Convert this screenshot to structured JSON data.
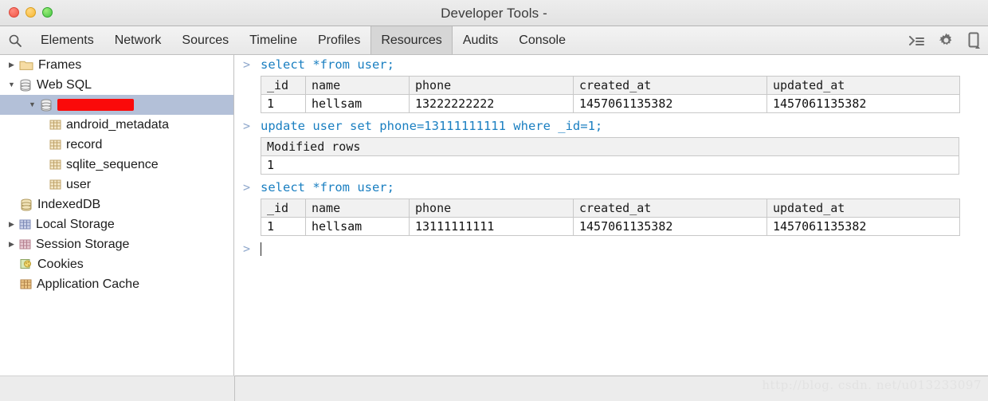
{
  "window": {
    "title": "Developer Tools -",
    "traffic_lights": [
      "close-red",
      "minimize-yellow",
      "zoom-green"
    ]
  },
  "toolbar": {
    "search_icon": "search-icon",
    "tabs": [
      {
        "label": "Elements",
        "active": false
      },
      {
        "label": "Network",
        "active": false
      },
      {
        "label": "Sources",
        "active": false
      },
      {
        "label": "Timeline",
        "active": false
      },
      {
        "label": "Profiles",
        "active": false
      },
      {
        "label": "Resources",
        "active": true
      },
      {
        "label": "Audits",
        "active": false
      },
      {
        "label": "Console",
        "active": false
      }
    ],
    "right_icons": [
      "console-drawer-icon",
      "gear-icon",
      "device-toolbar-icon"
    ]
  },
  "sidebar": {
    "items": [
      {
        "label": "Frames",
        "icon": "folder-icon",
        "twisty": "collapsed",
        "indent": 0,
        "selected": false
      },
      {
        "label": "Web SQL",
        "icon": "database-icon",
        "twisty": "expanded",
        "indent": 0,
        "selected": false
      },
      {
        "label": "",
        "icon": "database-icon",
        "twisty": "expanded",
        "indent": 1,
        "selected": true,
        "redacted": true
      },
      {
        "label": "android_metadata",
        "icon": "table-icon",
        "twisty": "none",
        "indent": 2,
        "selected": false
      },
      {
        "label": "record",
        "icon": "table-icon",
        "twisty": "none",
        "indent": 2,
        "selected": false
      },
      {
        "label": "sqlite_sequence",
        "icon": "table-icon",
        "twisty": "none",
        "indent": 2,
        "selected": false
      },
      {
        "label": "user",
        "icon": "table-icon",
        "twisty": "none",
        "indent": 2,
        "selected": false
      },
      {
        "label": "IndexedDB",
        "icon": "database-icon",
        "twisty": "none",
        "indent": 0,
        "selected": false
      },
      {
        "label": "Local Storage",
        "icon": "grid-blue-icon",
        "twisty": "collapsed",
        "indent": 0,
        "selected": false
      },
      {
        "label": "Session Storage",
        "icon": "grid-pink-icon",
        "twisty": "collapsed",
        "indent": 0,
        "selected": false
      },
      {
        "label": "Cookies",
        "icon": "cookie-icon",
        "twisty": "none",
        "indent": 0,
        "selected": false
      },
      {
        "label": "Application Cache",
        "icon": "grid-orange-icon",
        "twisty": "none",
        "indent": 0,
        "selected": false
      }
    ]
  },
  "console": {
    "prompt_symbol": ">",
    "entries": [
      {
        "type": "query",
        "command": "select *from user;",
        "columns": [
          "_id",
          "name",
          "phone",
          "created_at",
          "updated_at"
        ],
        "rows": [
          [
            "1",
            "hellsam",
            "13222222222",
            "1457061135382",
            "1457061135382"
          ]
        ]
      },
      {
        "type": "update",
        "command": "update user set phone=13111111111 where _id=1;",
        "columns": [
          "Modified rows"
        ],
        "rows": [
          [
            "1"
          ]
        ]
      },
      {
        "type": "query",
        "command": "select *from user;",
        "columns": [
          "_id",
          "name",
          "phone",
          "created_at",
          "updated_at"
        ],
        "rows": [
          [
            "1",
            "hellsam",
            "13111111111",
            "1457061135382",
            "1457061135382"
          ]
        ]
      }
    ],
    "input_value": ""
  },
  "watermark": "http://blog. csdn. net/u013233097",
  "colors": {
    "accent_blue": "#1a7fc1",
    "selection": "#b3c0d8",
    "redaction": "#fa0a0a",
    "tab_active_bg": "#d6d6d6"
  }
}
